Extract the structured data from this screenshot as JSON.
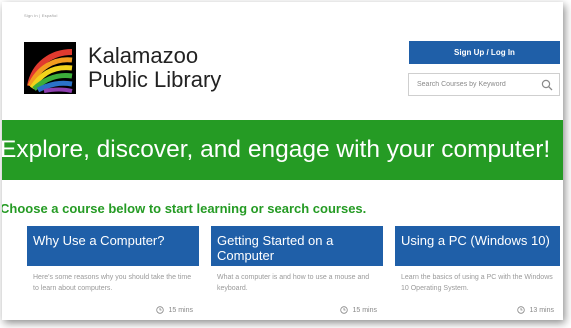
{
  "header": {
    "top_text": "Sign In | Español",
    "library_name_line1": "Kalamazoo",
    "library_name_line2": "Public Library",
    "signup_label": "Sign Up / Log In",
    "search_placeholder": "Search Courses by Keyword"
  },
  "banner": {
    "headline": "Explore, discover, and engage with your computer!"
  },
  "subheading": "Choose a course below to start learning or search courses.",
  "courses": [
    {
      "title": "Why Use a Computer?",
      "description": "Here's some reasons why you should take the time to learn about computers.",
      "duration": "15 mins"
    },
    {
      "title": "Getting Started on a Computer",
      "description": "What a computer is and how to use a mouse and keyboard.",
      "duration": "15 mins"
    },
    {
      "title": "Using a PC (Windows 10)",
      "description": "Learn the basics of using a PC with the Windows 10 Operating System.",
      "duration": "13 mins"
    }
  ],
  "colors": {
    "brand_blue": "#1f5fa8",
    "brand_green": "#259b24"
  }
}
